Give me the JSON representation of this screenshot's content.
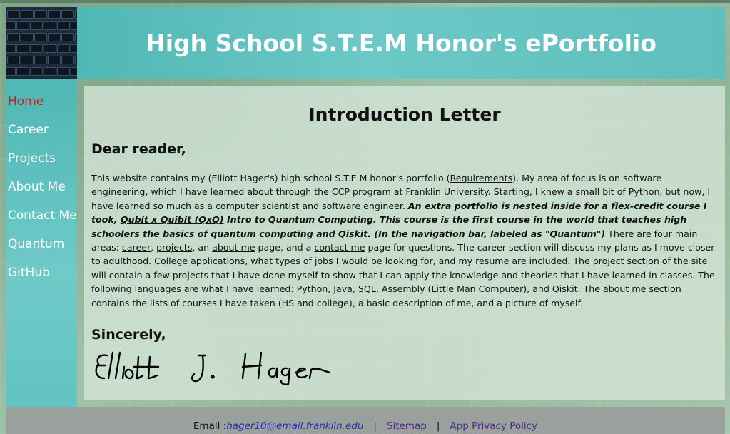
{
  "header": {
    "title": "High School S.T.E.M Honor's ePortfolio",
    "logo_icon": "keyboard-image"
  },
  "nav": {
    "items": [
      {
        "label": "Home",
        "active": true
      },
      {
        "label": "Career",
        "active": false
      },
      {
        "label": "Projects",
        "active": false
      },
      {
        "label": "About Me",
        "active": false
      },
      {
        "label": "Contact Me",
        "active": false
      },
      {
        "label": "Quantum",
        "active": false
      },
      {
        "label": "GitHub",
        "active": false
      }
    ],
    "active_color": "#d81818"
  },
  "main": {
    "heading": "Introduction Letter",
    "greeting": "Dear reader,",
    "body": {
      "p1": "This website contains my (Elliott Hager's) high school S.T.E.M honor's portfolio (",
      "requirements_link": "Requirements",
      "p2": "). My area of focus is on software engineering, which I have learned about through the CCP program at Franklin University. Starting, I knew a small bit of Python, but now, I have learned so much as a computer scientist and software engineer. ",
      "bi1": "An extra portfolio is nested inside for a flex-credit course I took, ",
      "qxq_link": "Qubit x Quibit (QxQ)",
      "bi2": " Intro to Quantum Computing. This course is the first course in the world that teaches high schoolers the basics of quantum computing and Qiskit. (In the navigation bar, labeled as \"Quantum\")",
      "p3": " There are four main areas: ",
      "career_link": "career",
      "comma1": ", ",
      "projects_link": "projects",
      "an": ", an ",
      "aboutme_link": "about me",
      "p4": " page, and a ",
      "contactme_link": "contact me",
      "p5": " page for questions. The career section will discuss my plans as I move closer to adulthood. College applications, what types of jobs I would be looking for, and my resume are included. The project section of the site will contain a few projects that I have done myself to show that I can apply the knowledge and theories that I have learned in classes. The following languages are what I have learned: Python, Java, SQL, Assembly (Little Man Computer), and Qiskit. The about me section contains the lists of courses I have taken (HS and college), a basic description of me, and a picture of myself."
    },
    "closing": "Sincerely,",
    "signature": "Elliott J. Hager"
  },
  "footer": {
    "email_label": "Email : ",
    "email": "hager10@email.franklin.edu",
    "separator": "|",
    "sitemap": "Sitemap",
    "privacy": "App Privacy Policy"
  }
}
